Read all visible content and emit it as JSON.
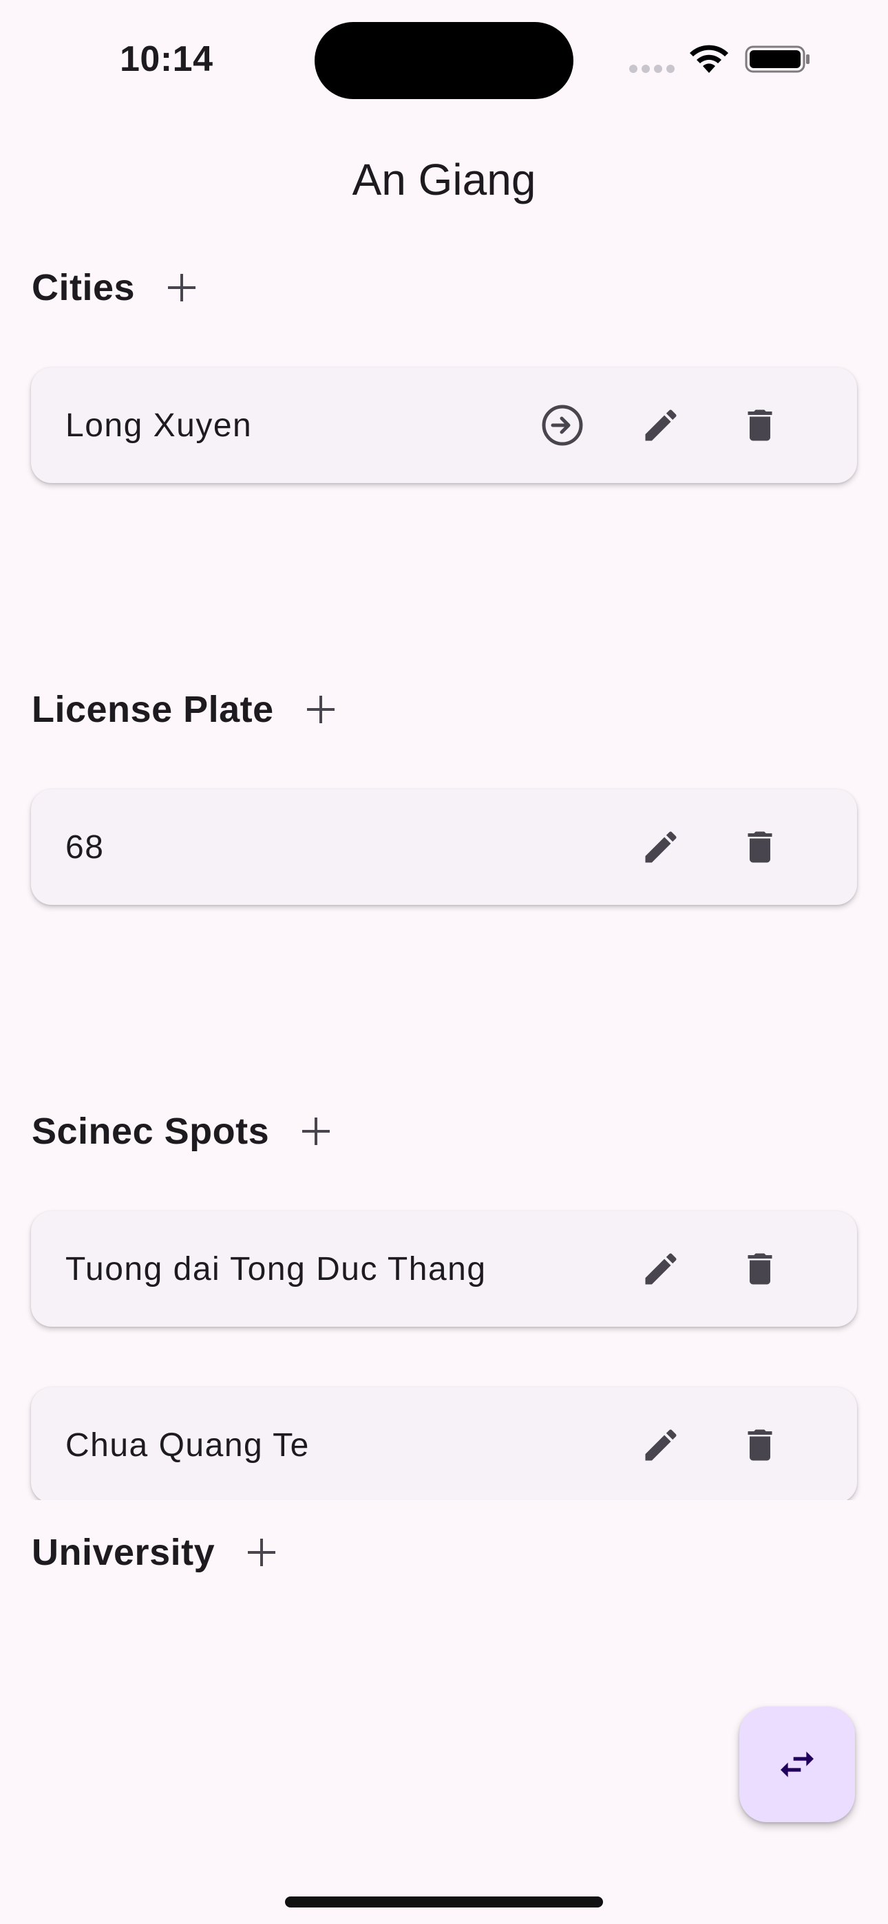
{
  "status_bar": {
    "time": "10:14"
  },
  "page": {
    "title": "An Giang"
  },
  "sections": {
    "cities": {
      "title": "Cities",
      "items": [
        {
          "label": "Long Xuyen"
        }
      ]
    },
    "license_plate": {
      "title": "License Plate",
      "items": [
        {
          "label": "68"
        }
      ]
    },
    "scenic_spots": {
      "title": "Scinec Spots",
      "items": [
        {
          "label": "Tuong dai Tong Duc Thang"
        },
        {
          "label": "Chua Quang Te"
        }
      ]
    },
    "university": {
      "title": "University"
    }
  },
  "icons": {
    "add": "plus-icon",
    "navigate": "arrow-circle-right-icon",
    "edit": "pencil-icon",
    "delete": "trash-icon",
    "fab": "swap-horiz-icon"
  },
  "colors": {
    "background": "#fdf7fc",
    "card": "#f6f2f7",
    "icon": "#49454f",
    "fab": "#eaddff",
    "fab_icon": "#21005d"
  }
}
